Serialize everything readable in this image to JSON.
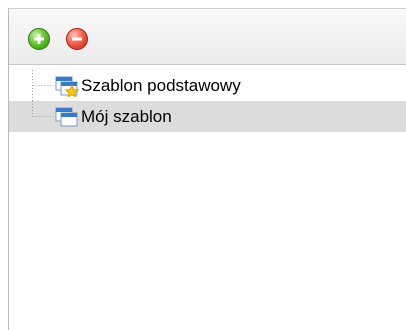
{
  "toolbar": {
    "add_icon": "plus-circle-icon",
    "remove_icon": "minus-circle-icon",
    "add_color": "#4fb320",
    "remove_color": "#e4473a"
  },
  "tree": {
    "items": [
      {
        "label": "Szablon podstawowy",
        "icon": "template-default-icon",
        "selected": false
      },
      {
        "label": "Mój szablon",
        "icon": "template-icon",
        "selected": true
      }
    ],
    "selection_color": "#dcdcdc"
  }
}
